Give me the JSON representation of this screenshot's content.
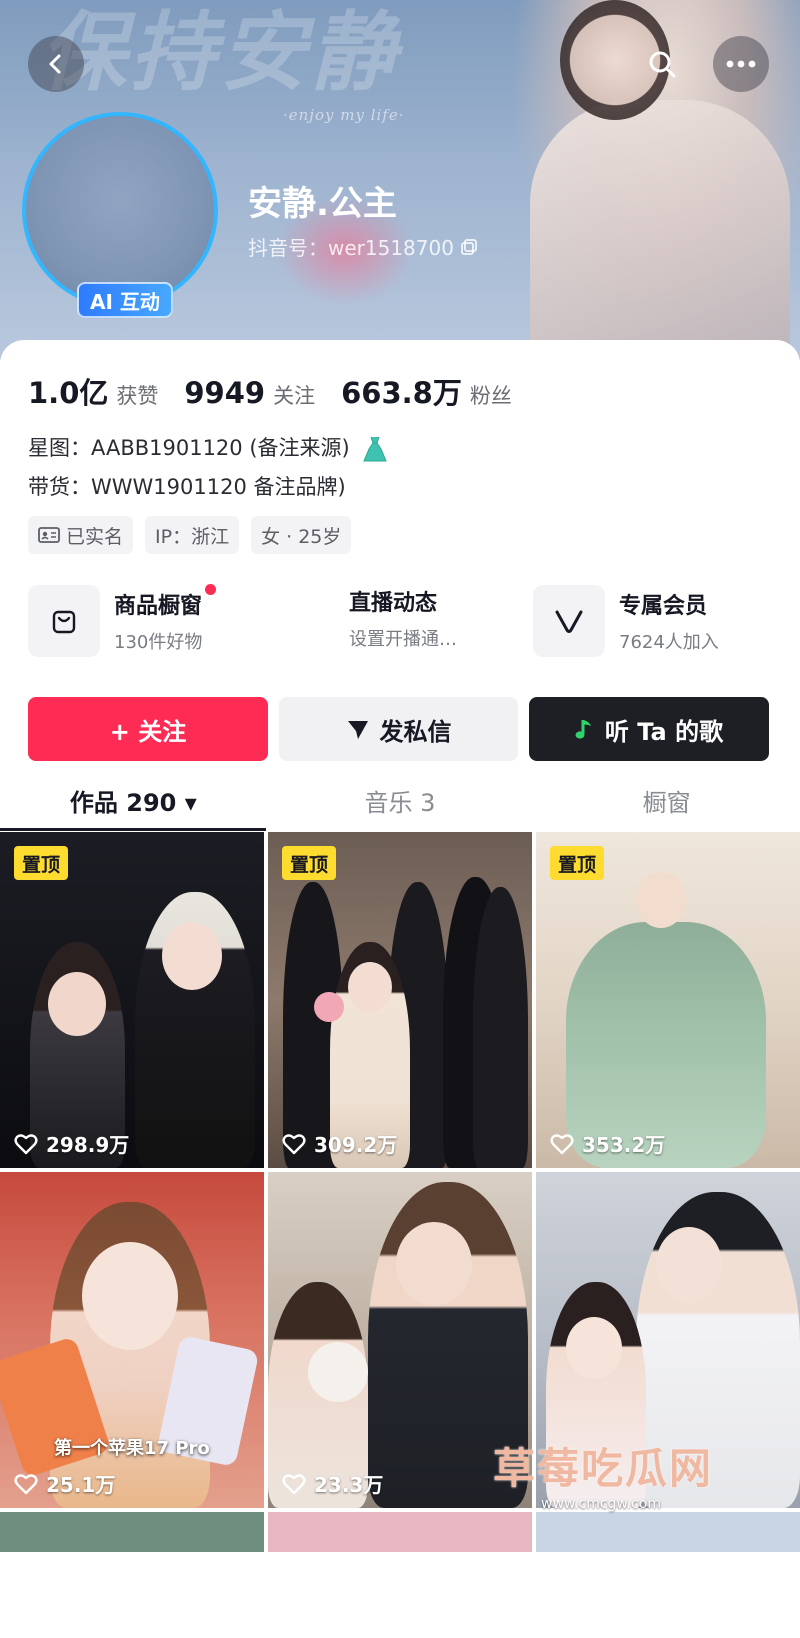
{
  "banner": {
    "bg_title": "保持安静",
    "bg_subtitle": "·enjoy my life·"
  },
  "profile": {
    "nickname": "安静.公主",
    "douyin_id": "抖音号：wer1518700",
    "ai_badge": "AI 互动"
  },
  "stats": [
    {
      "num": "1.0亿",
      "label": "获赞"
    },
    {
      "num": "9949",
      "label": "关注"
    },
    {
      "num": "663.8万",
      "label": "粉丝"
    }
  ],
  "info": {
    "line1": "星图：AABB1901120 (备注来源)",
    "line2": "带货：WWW1901120 备注品牌)"
  },
  "tags": [
    {
      "label": "已实名",
      "icon": "id-card-icon"
    },
    {
      "label": "IP：浙江"
    },
    {
      "label": "女 · 25岁"
    }
  ],
  "services": [
    {
      "title": "商品橱窗",
      "sub": "130件好物",
      "icon": "shopping-bag-icon",
      "dot": true
    },
    {
      "title": "直播动态",
      "sub": "设置开播通…"
    },
    {
      "title": "专属会员",
      "sub": "7624人加入",
      "icon": "vip-v-icon"
    }
  ],
  "actions": {
    "follow": "+ 关注",
    "message": "发私信",
    "song": "听 Ta 的歌"
  },
  "tabs": [
    {
      "label": "作品 290 ▾"
    },
    {
      "label": "音乐 3"
    },
    {
      "label": "橱窗"
    }
  ],
  "videos": [
    {
      "pinned": "置顶",
      "likes": "298.9万"
    },
    {
      "pinned": "置顶",
      "likes": "309.2万"
    },
    {
      "pinned": "置顶",
      "likes": "353.2万"
    },
    {
      "likes": "25.1万",
      "caption": "第一个苹果17 Pro"
    },
    {
      "likes": "23.3万"
    },
    {
      "likes": ""
    }
  ],
  "watermark": {
    "text": "草莓吃瓜网",
    "url": "www.cmcgw.com"
  },
  "colors": {
    "accent": "#fe2c55",
    "pin": "#fddc2f",
    "dark_button": "#1e1f25",
    "avatar_ring": "#33b6ff"
  }
}
